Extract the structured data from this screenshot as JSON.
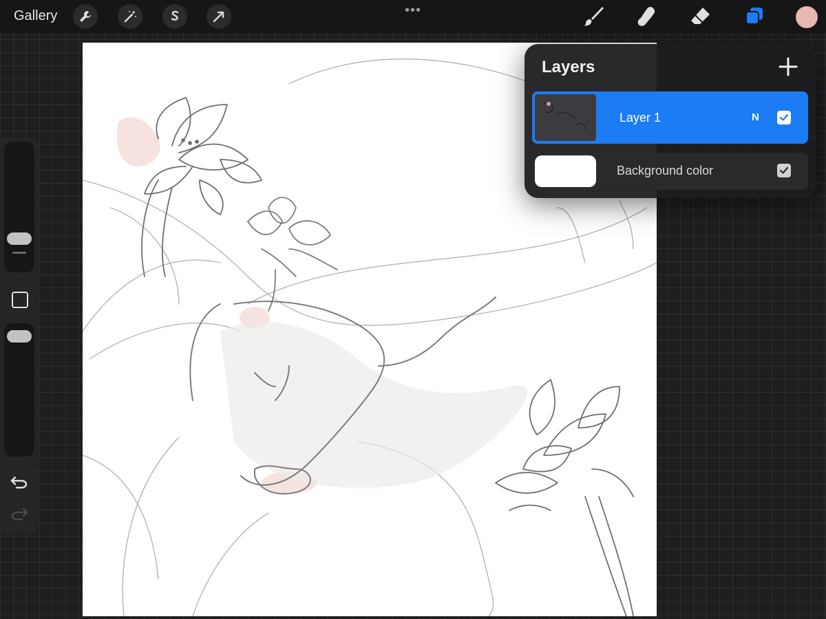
{
  "topbar": {
    "gallery_label": "Gallery",
    "left_tools": [
      "wrench-icon",
      "magic-wand-icon",
      "selection-s-icon",
      "arrow-transform-icon"
    ],
    "more_label": "•••",
    "right_tools": [
      "brush-icon",
      "smudge-icon",
      "eraser-icon",
      "layers-icon"
    ],
    "current_color": "#e8b8b2",
    "active_tool_color": "#1c7cf3"
  },
  "sidebar": {
    "controls": [
      "brush-size-slider",
      "modify-button",
      "opacity-slider",
      "undo-icon",
      "redo-icon"
    ]
  },
  "layers_panel": {
    "title": "Layers",
    "add_icon": "plus-icon",
    "layers": [
      {
        "name": "Layer 1",
        "blend_mode": "N",
        "visible": true,
        "selected": true
      },
      {
        "name": "Background color",
        "visible": true,
        "selected": false
      }
    ]
  }
}
